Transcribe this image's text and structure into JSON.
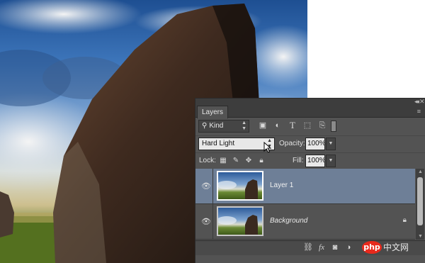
{
  "panel": {
    "tab_label": "Layers",
    "collapse_glyph": "◂◂",
    "close_glyph": "✕",
    "menu_glyph": "≡"
  },
  "filter": {
    "kind_label": "Kind",
    "icons": [
      "image-filter-icon",
      "adjustment-filter-icon",
      "type-filter-icon",
      "shape-filter-icon",
      "smart-object-filter-icon"
    ]
  },
  "blend": {
    "mode": "Hard Light",
    "opacity_label": "Opacity:",
    "opacity_value": "100%"
  },
  "lock": {
    "label": "Lock:",
    "fill_label": "Fill:",
    "fill_value": "100%"
  },
  "layers": [
    {
      "name": "Layer 1",
      "selected": true,
      "visible": true,
      "locked": false
    },
    {
      "name": "Background",
      "selected": false,
      "visible": true,
      "locked": true
    }
  ],
  "watermark": {
    "logo": "php",
    "text": "中文网"
  }
}
